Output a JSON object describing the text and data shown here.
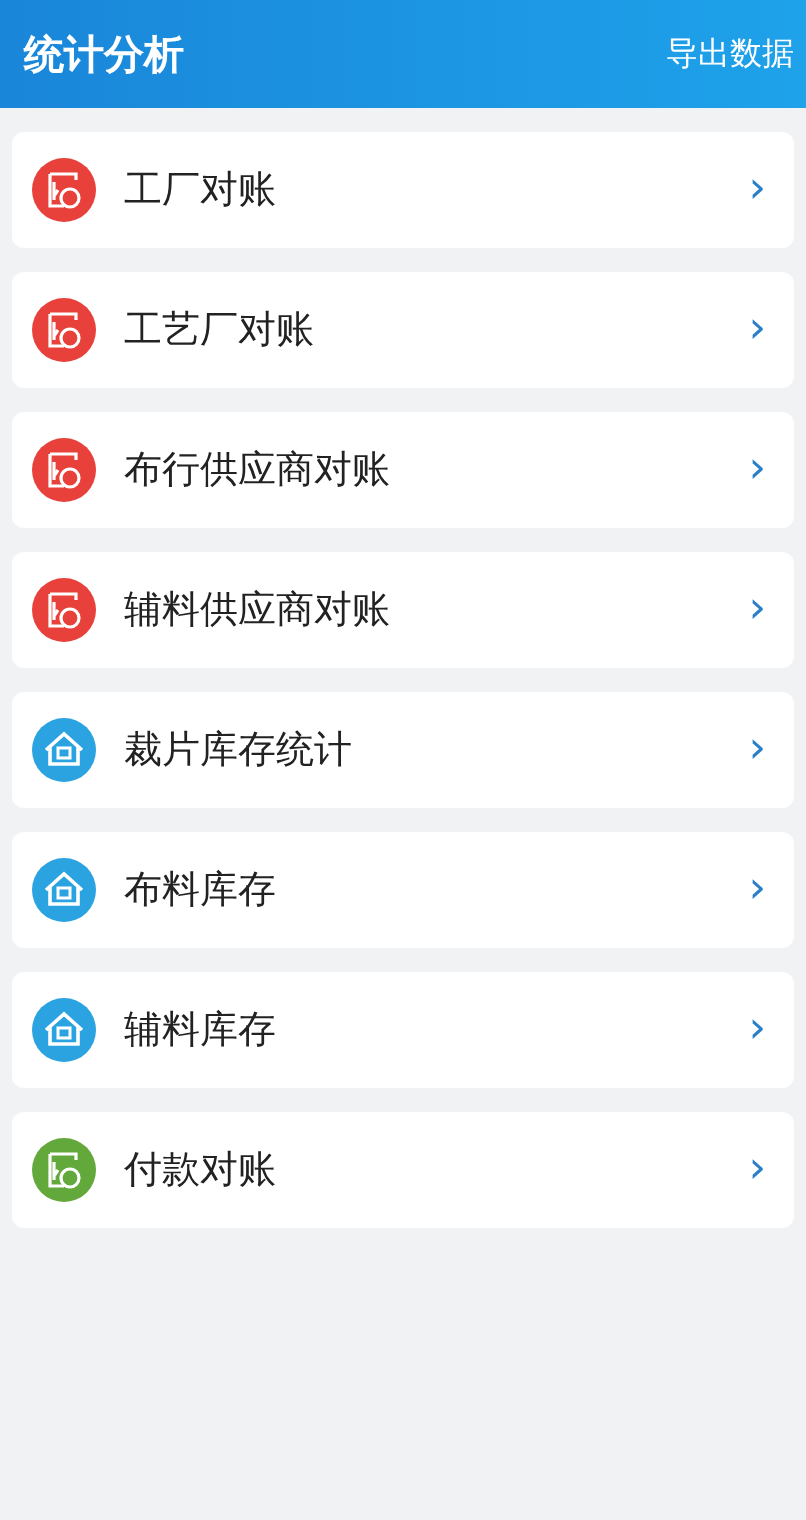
{
  "header": {
    "title": "统计分析",
    "action": "导出数据"
  },
  "items": [
    {
      "label": "工厂对账",
      "kind": "ledger",
      "color": "#e8403a",
      "chevron": "›"
    },
    {
      "label": "工艺厂对账",
      "kind": "ledger",
      "color": "#e8403a",
      "chevron": "›"
    },
    {
      "label": "布行供应商对账",
      "kind": "ledger",
      "color": "#e8403a",
      "chevron": "›"
    },
    {
      "label": "辅料供应商对账",
      "kind": "ledger",
      "color": "#e8403a",
      "chevron": "›"
    },
    {
      "label": "裁片库存统计",
      "kind": "warehouse",
      "color": "#2ba3e0",
      "chevron": "›"
    },
    {
      "label": "布料库存",
      "kind": "warehouse",
      "color": "#2ba3e0",
      "chevron": "›"
    },
    {
      "label": "辅料库存",
      "kind": "warehouse",
      "color": "#2ba3e0",
      "chevron": "›"
    },
    {
      "label": "付款对账",
      "kind": "ledger",
      "color": "#62a83a",
      "chevron": "›"
    }
  ]
}
